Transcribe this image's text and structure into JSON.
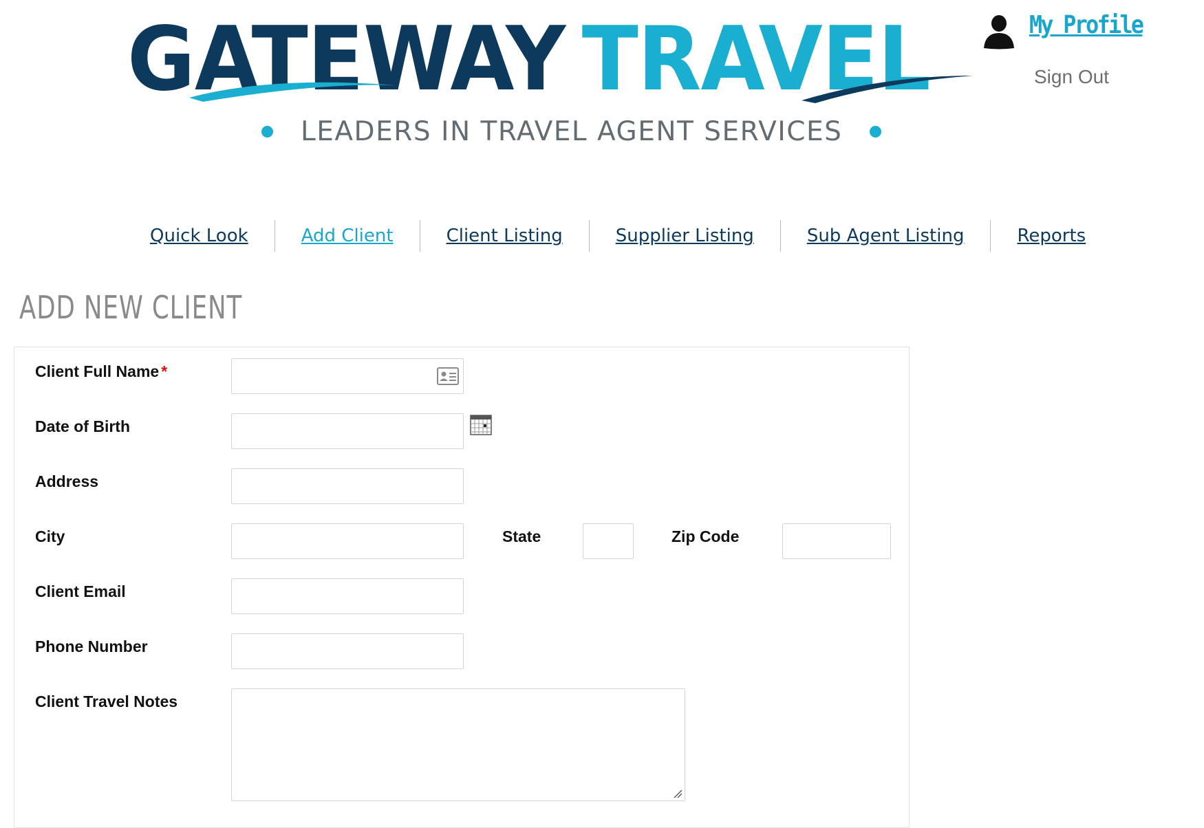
{
  "brand": {
    "word1": "GATEWAY",
    "word2": "TRAVEL",
    "tagline": "LEADERS IN TRAVEL AGENT SERVICES",
    "colors": {
      "navy": "#0d3a5c",
      "teal": "#1aaed0",
      "gray": "#636c72"
    }
  },
  "profile": {
    "icon": "user-icon",
    "my_profile_label": "My Profile",
    "sign_out_label": "Sign Out"
  },
  "nav": {
    "items": [
      {
        "label": "Quick Look",
        "active": false
      },
      {
        "label": "Add Client",
        "active": true
      },
      {
        "label": "Client Listing",
        "active": false
      },
      {
        "label": "Supplier Listing",
        "active": false
      },
      {
        "label": "Sub Agent Listing",
        "active": false
      },
      {
        "label": "Reports",
        "active": false
      }
    ]
  },
  "page": {
    "title": "ADD NEW CLIENT"
  },
  "form": {
    "full_name": {
      "label": "Client Full Name",
      "required_marker": "*",
      "value": "",
      "icon": "contact-card-icon"
    },
    "dob": {
      "label": "Date of Birth",
      "value": "",
      "icon": "calendar-icon"
    },
    "address": {
      "label": "Address",
      "value": ""
    },
    "city": {
      "label": "City",
      "value": ""
    },
    "state": {
      "label": "State",
      "value": ""
    },
    "zip": {
      "label": "Zip Code",
      "value": ""
    },
    "email": {
      "label": "Client Email",
      "value": ""
    },
    "phone": {
      "label": "Phone Number",
      "value": ""
    },
    "notes": {
      "label": "Client Travel Notes",
      "value": ""
    }
  }
}
